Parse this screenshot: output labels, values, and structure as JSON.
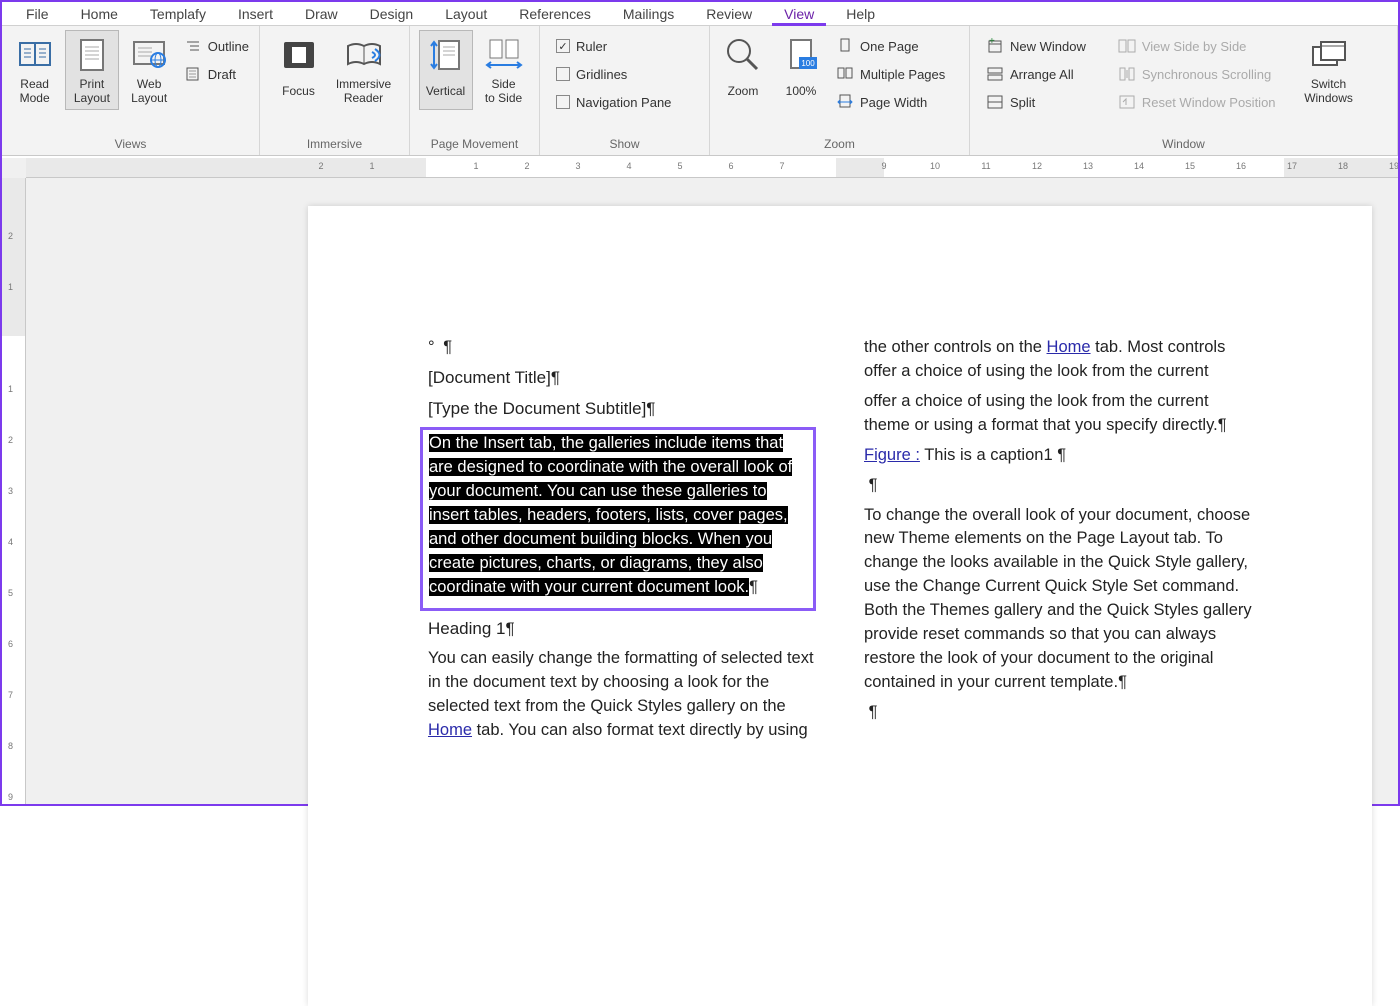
{
  "tabs": [
    "File",
    "Home",
    "Templafy",
    "Insert",
    "Draw",
    "Design",
    "Layout",
    "References",
    "Mailings",
    "Review",
    "View",
    "Help"
  ],
  "active_tab": "View",
  "groups": {
    "views": {
      "label": "Views",
      "read_mode": "Read\nMode",
      "print_layout": "Print\nLayout",
      "web_layout": "Web\nLayout",
      "outline": "Outline",
      "draft": "Draft"
    },
    "immersive": {
      "label": "Immersive",
      "focus": "Focus",
      "reader": "Immersive\nReader"
    },
    "page_movement": {
      "label": "Page Movement",
      "vertical": "Vertical",
      "side": "Side\nto Side"
    },
    "show": {
      "label": "Show",
      "ruler": "Ruler",
      "gridlines": "Gridlines",
      "nav": "Navigation Pane",
      "ruler_checked": true
    },
    "zoom": {
      "label": "Zoom",
      "zoom": "Zoom",
      "hundred": "100%",
      "one_page": "One Page",
      "multi": "Multiple Pages",
      "width": "Page Width"
    },
    "window": {
      "label": "Window",
      "new": "New Window",
      "arrange": "Arrange All",
      "split": "Split",
      "side_by_side": "View Side by Side",
      "sync": "Synchronous Scrolling",
      "reset": "Reset Window Position",
      "switch": "Switch\nWindows"
    }
  },
  "ruler_h_numbers": [
    2,
    1,
    1,
    2,
    3,
    4,
    5,
    6,
    7,
    9,
    10,
    11,
    12,
    13,
    14,
    15,
    16,
    17,
    18,
    19
  ],
  "ruler_v_numbers": [
    2,
    1,
    1,
    2,
    3,
    4,
    5,
    6,
    7,
    8,
    9
  ],
  "document": {
    "title": "[Document Title]",
    "subtitle": "[Type the Document Subtitle]",
    "selected_para": "On the Insert tab, the galleries include items that are designed to coordinate with the overall look of your document. You can use these galleries to insert tables, headers, footers, lists, cover pages, and other document building blocks. When you create pictures, charts, or diagrams, they also coordinate with your current document look.",
    "heading1": "Heading 1",
    "para2a": "You can easily change the formatting of selected text in the document text by choosing a look for the selected text from the Quick Styles gallery on the ",
    "home_link": "Home",
    "para2b": " tab. You can also format text directly by using the other controls on the ",
    "para2c": " tab. Most controls offer a choice of using the look from the current",
    "col2_top": "offer a choice of using the look from the current theme or using a format that you specify directly.",
    "fig_label": "Figure :",
    "fig_text": " This is a caption1",
    "col2_para": "To change the overall look of your document, choose new Theme elements on the Page Layout tab. To change the looks available in the Quick Style gallery, use the Change Current Quick Style Set command. Both the Themes gallery and the Quick Styles gallery provide reset commands so that you can always restore the look of your document to the original contained in your current template."
  }
}
